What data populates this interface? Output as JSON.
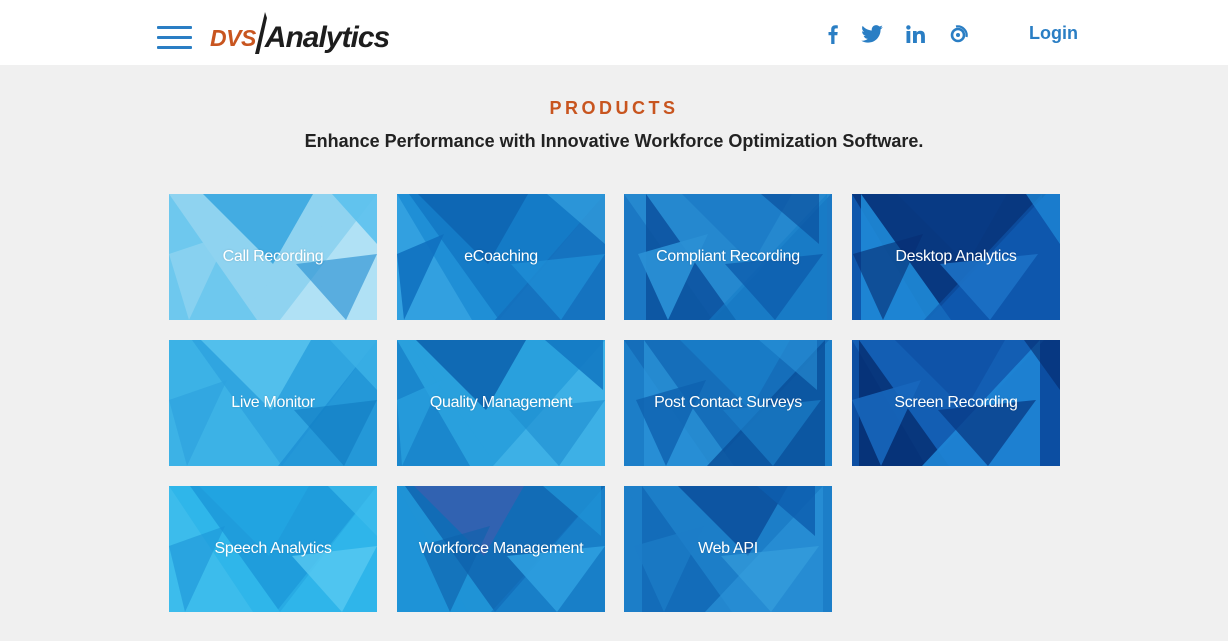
{
  "header": {
    "logo_dvs": "DVS",
    "logo_analytics": "Analytics",
    "login_label": "Login"
  },
  "icons": {
    "menu": "hamburger-menu-icon",
    "facebook": "facebook-icon",
    "twitter": "twitter-icon",
    "linkedin": "linkedin-icon",
    "blog": "blog-icon"
  },
  "colors": {
    "accent_blue": "#2a7ec4",
    "brand_orange": "#c8551f",
    "background": "#f0f0f0"
  },
  "products": {
    "title": "PRODUCTS",
    "subtitle": "Enhance Performance with Innovative Workforce Optimization Software.",
    "items": [
      {
        "label": "Call Recording"
      },
      {
        "label": "eCoaching"
      },
      {
        "label": "Compliant Recording"
      },
      {
        "label": "Desktop Analytics"
      },
      {
        "label": "Live Monitor"
      },
      {
        "label": "Quality Management"
      },
      {
        "label": "Post Contact Surveys"
      },
      {
        "label": "Screen Recording"
      },
      {
        "label": "Speech Analytics"
      },
      {
        "label": "Workforce Management"
      },
      {
        "label": "Web API"
      }
    ]
  }
}
